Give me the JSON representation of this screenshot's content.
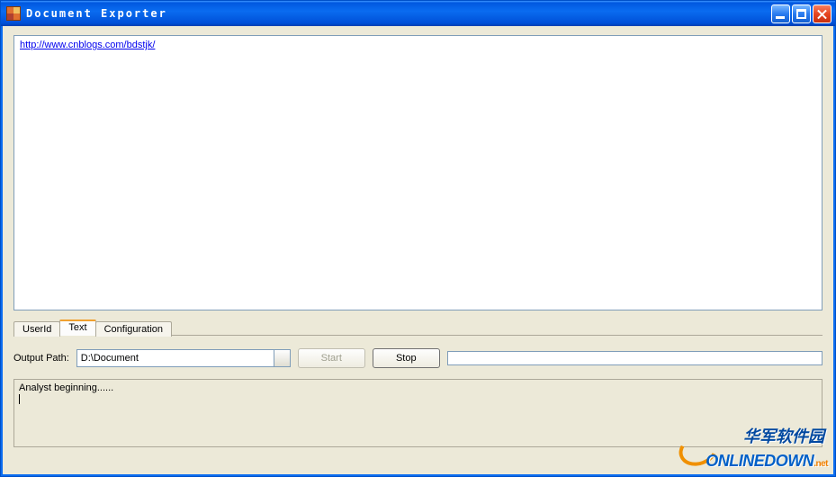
{
  "window": {
    "title": "Document Exporter"
  },
  "url_list": [
    "http://www.cnblogs.com/bdstjk/"
  ],
  "tabs": {
    "items": [
      "UserId",
      "Text",
      "Configuration"
    ],
    "active_index": 1
  },
  "output": {
    "label": "Output Path:",
    "value": "D:\\Document"
  },
  "buttons": {
    "start": "Start",
    "stop": "Stop",
    "start_enabled": false,
    "stop_enabled": true
  },
  "log": {
    "lines": [
      "Analyst beginning......"
    ]
  },
  "watermark": {
    "cn": "华军软件园",
    "en": "ONLINEDOWN",
    "suffix": ".net"
  }
}
